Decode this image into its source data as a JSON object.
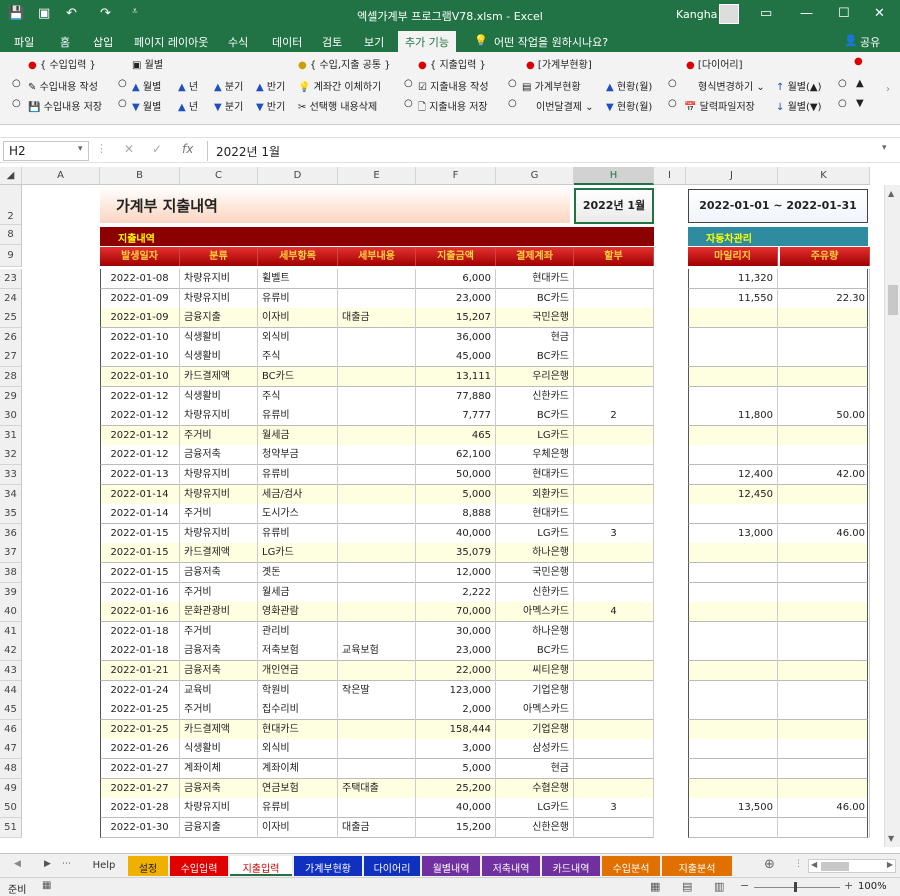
{
  "app": {
    "window_title": "엑셀가계부 프로그램V78.xlsm  -  Excel",
    "user_name": "Kangha",
    "tell_me": "어떤 작업을 원하시나요?",
    "share": "공유"
  },
  "ribbon_tabs": [
    "파일",
    "홈",
    "삽입",
    "페이지 레이아웃",
    "수식",
    "데이터",
    "검토",
    "보기",
    "추가 기능"
  ],
  "active_ribbon_tab": "추가 기능",
  "ribbon": {
    "group_income": "{ 수입입력 }",
    "monthly": "월별",
    "group_common": "{ 수입,지출 공통 }",
    "group_expense": "{ 지출입력 }",
    "group_status": "[가계부현황]",
    "group_diary": "[다이어리]",
    "row1": {
      "income_write": "수입내용 작성",
      "m1": "월별",
      "y1": "년",
      "q1": "분기",
      "h1": "반기",
      "transfer": "계좌간 이체하기",
      "exp_write": "지출내용 작성",
      "hh_status": "가계부현황",
      "status_m1": "현황(월)",
      "format_change": "형식변경하기",
      "monthly_up": "월별(▲)"
    },
    "row2": {
      "income_save": "수입내용 저장",
      "m2": "월별",
      "y2": "년",
      "q2": "분기",
      "h2": "반기",
      "del_selected": "선택행 내용삭제",
      "exp_save": "지출내용 저장",
      "next_month": "이번달결제",
      "status_m2": "현황(월)",
      "cal_save": "달력파일저장",
      "monthly_down": "월별(▼)"
    }
  },
  "formula_bar": {
    "name_box": "H2",
    "value": "2022년 1월"
  },
  "columns": [
    "A",
    "B",
    "C",
    "D",
    "E",
    "F",
    "G",
    "H",
    "I",
    "J",
    "K"
  ],
  "selected_column": "H",
  "sheet": {
    "title": "가계부 지출내역",
    "month_box": "2022년 1월",
    "period": "2022-01-01  ~  2022-01-31",
    "section_label": "지출내역",
    "car_section_label": "자동차관리",
    "headers": [
      "발생일자",
      "분류",
      "세부항목",
      "세부내용",
      "지출금액",
      "결제계좌",
      "할부"
    ],
    "car_headers": [
      "마일리지",
      "주유량"
    ],
    "rows": [
      {
        "row": "23",
        "date": "2022-01-08",
        "cat": "차량유지비",
        "item": "휠벨트",
        "detail": "",
        "amount": "6,000",
        "account": "현대카드",
        "inst": "",
        "mileage": "11,320",
        "fuel": ""
      },
      {
        "row": "24",
        "date": "2022-01-09",
        "cat": "차량유지비",
        "item": "유류비",
        "detail": "",
        "amount": "23,000",
        "account": "BC카드",
        "inst": "",
        "mileage": "11,550",
        "fuel": "22.30"
      },
      {
        "row": "25",
        "date": "2022-01-09",
        "cat": "금융지출",
        "item": "이자비",
        "detail": "대출금",
        "amount": "15,207",
        "account": "국민은행",
        "inst": "",
        "mileage": "",
        "fuel": ""
      },
      {
        "row": "26",
        "date": "2022-01-10",
        "cat": "식생활비",
        "item": "외식비",
        "detail": "",
        "amount": "36,000",
        "account": "현금",
        "inst": "",
        "mileage": "",
        "fuel": ""
      },
      {
        "row": "27",
        "date": "2022-01-10",
        "cat": "식생활비",
        "item": "주식",
        "detail": "",
        "amount": "45,000",
        "account": "BC카드",
        "inst": "",
        "mileage": "",
        "fuel": ""
      },
      {
        "row": "28",
        "date": "2022-01-10",
        "cat": "카드결제액",
        "item": "BC카드",
        "detail": "",
        "amount": "13,111",
        "account": "우리은행",
        "inst": "",
        "mileage": "",
        "fuel": ""
      },
      {
        "row": "29",
        "date": "2022-01-12",
        "cat": "식생활비",
        "item": "주식",
        "detail": "",
        "amount": "77,880",
        "account": "신한카드",
        "inst": "",
        "mileage": "",
        "fuel": ""
      },
      {
        "row": "30",
        "date": "2022-01-12",
        "cat": "차량유지비",
        "item": "유류비",
        "detail": "",
        "amount": "7,777",
        "account": "BC카드",
        "inst": "2",
        "mileage": "11,800",
        "fuel": "50.00"
      },
      {
        "row": "31",
        "date": "2022-01-12",
        "cat": "주거비",
        "item": "월세금",
        "detail": "",
        "amount": "465",
        "account": "LG카드",
        "inst": "",
        "mileage": "",
        "fuel": ""
      },
      {
        "row": "32",
        "date": "2022-01-12",
        "cat": "금융저축",
        "item": "청약부금",
        "detail": "",
        "amount": "62,100",
        "account": "우체은행",
        "inst": "",
        "mileage": "",
        "fuel": ""
      },
      {
        "row": "33",
        "date": "2022-01-13",
        "cat": "차량유지비",
        "item": "유류비",
        "detail": "",
        "amount": "50,000",
        "account": "현대카드",
        "inst": "",
        "mileage": "12,400",
        "fuel": "42.00"
      },
      {
        "row": "34",
        "date": "2022-01-14",
        "cat": "차량유지비",
        "item": "세금/검사",
        "detail": "",
        "amount": "5,000",
        "account": "외환카드",
        "inst": "",
        "mileage": "12,450",
        "fuel": ""
      },
      {
        "row": "35",
        "date": "2022-01-14",
        "cat": "주거비",
        "item": "도시가스",
        "detail": "",
        "amount": "8,888",
        "account": "현대카드",
        "inst": "",
        "mileage": "",
        "fuel": ""
      },
      {
        "row": "36",
        "date": "2022-01-15",
        "cat": "차량유지비",
        "item": "유류비",
        "detail": "",
        "amount": "40,000",
        "account": "LG카드",
        "inst": "3",
        "mileage": "13,000",
        "fuel": "46.00"
      },
      {
        "row": "37",
        "date": "2022-01-15",
        "cat": "카드결제액",
        "item": "LG카드",
        "detail": "",
        "amount": "35,079",
        "account": "하나은행",
        "inst": "",
        "mileage": "",
        "fuel": ""
      },
      {
        "row": "38",
        "date": "2022-01-15",
        "cat": "금융저축",
        "item": "곗돈",
        "detail": "",
        "amount": "12,000",
        "account": "국민은행",
        "inst": "",
        "mileage": "",
        "fuel": ""
      },
      {
        "row": "39",
        "date": "2022-01-16",
        "cat": "주거비",
        "item": "월세금",
        "detail": "",
        "amount": "2,222",
        "account": "신한카드",
        "inst": "",
        "mileage": "",
        "fuel": ""
      },
      {
        "row": "40",
        "date": "2022-01-16",
        "cat": "문화관광비",
        "item": "영화관람",
        "detail": "",
        "amount": "70,000",
        "account": "아멕스카드",
        "inst": "4",
        "mileage": "",
        "fuel": ""
      },
      {
        "row": "41",
        "date": "2022-01-18",
        "cat": "주거비",
        "item": "관리비",
        "detail": "",
        "amount": "30,000",
        "account": "하나은행",
        "inst": "",
        "mileage": "",
        "fuel": ""
      },
      {
        "row": "42",
        "date": "2022-01-18",
        "cat": "금융저축",
        "item": "저축보험",
        "detail": "교육보험",
        "amount": "23,000",
        "account": "BC카드",
        "inst": "",
        "mileage": "",
        "fuel": ""
      },
      {
        "row": "43",
        "date": "2022-01-21",
        "cat": "금융저축",
        "item": "개인연금",
        "detail": "",
        "amount": "22,000",
        "account": "씨티은행",
        "inst": "",
        "mileage": "",
        "fuel": ""
      },
      {
        "row": "44",
        "date": "2022-01-24",
        "cat": "교육비",
        "item": "학원비",
        "detail": "작은딸",
        "amount": "123,000",
        "account": "기업은행",
        "inst": "",
        "mileage": "",
        "fuel": ""
      },
      {
        "row": "45",
        "date": "2022-01-25",
        "cat": "주거비",
        "item": "집수리비",
        "detail": "",
        "amount": "2,000",
        "account": "아멕스카드",
        "inst": "",
        "mileage": "",
        "fuel": ""
      },
      {
        "row": "46",
        "date": "2022-01-25",
        "cat": "카드결제액",
        "item": "현대카드",
        "detail": "",
        "amount": "158,444",
        "account": "기업은행",
        "inst": "",
        "mileage": "",
        "fuel": ""
      },
      {
        "row": "47",
        "date": "2022-01-26",
        "cat": "식생활비",
        "item": "외식비",
        "detail": "",
        "amount": "3,000",
        "account": "삼성카드",
        "inst": "",
        "mileage": "",
        "fuel": ""
      },
      {
        "row": "48",
        "date": "2022-01-27",
        "cat": "계좌이체",
        "item": "계좌이체",
        "detail": "",
        "amount": "5,000",
        "account": "현금",
        "inst": "",
        "mileage": "",
        "fuel": ""
      },
      {
        "row": "49",
        "date": "2022-01-27",
        "cat": "금융저축",
        "item": "연금보험",
        "detail": "주택대출",
        "amount": "25,200",
        "account": "수협은행",
        "inst": "",
        "mileage": "",
        "fuel": ""
      },
      {
        "row": "50",
        "date": "2022-01-28",
        "cat": "차량유지비",
        "item": "유류비",
        "detail": "",
        "amount": "40,000",
        "account": "LG카드",
        "inst": "3",
        "mileage": "13,500",
        "fuel": "46.00"
      },
      {
        "row": "51",
        "date": "2022-01-30",
        "cat": "금융지출",
        "item": "이자비",
        "detail": "대출금",
        "amount": "15,200",
        "account": "신한은행",
        "inst": "",
        "mileage": "",
        "fuel": ""
      }
    ]
  },
  "sheet_tabs": [
    {
      "label": "Help",
      "color": "#f0f0f0",
      "text": "#333"
    },
    {
      "label": "설정",
      "color": "#f0b000",
      "text": "#222"
    },
    {
      "label": "수입입력",
      "color": "#e00000",
      "text": "#fff"
    },
    {
      "label": "지출입력",
      "color": "#f4c8c8",
      "text": "#c00"
    },
    {
      "label": "가계부현황",
      "color": "#1030c0",
      "text": "#fff"
    },
    {
      "label": "다이어리",
      "color": "#1030c0",
      "text": "#fff"
    },
    {
      "label": "월별내역",
      "color": "#7030a0",
      "text": "#fff"
    },
    {
      "label": "저축내역",
      "color": "#7030a0",
      "text": "#fff"
    },
    {
      "label": "카드내역",
      "color": "#7030a0",
      "text": "#fff"
    },
    {
      "label": "수입분석",
      "color": "#e07000",
      "text": "#fff"
    },
    {
      "label": "지출분석",
      "color": "#e07000",
      "text": "#fff"
    }
  ],
  "status": {
    "ready": "준비",
    "zoom": "100%"
  },
  "colors": {
    "excel_green": "#217346",
    "header_red": "#c00000",
    "car_teal": "#2e8ba0",
    "row_yellow": "#fefee0",
    "row_green": "#eef6e2"
  }
}
